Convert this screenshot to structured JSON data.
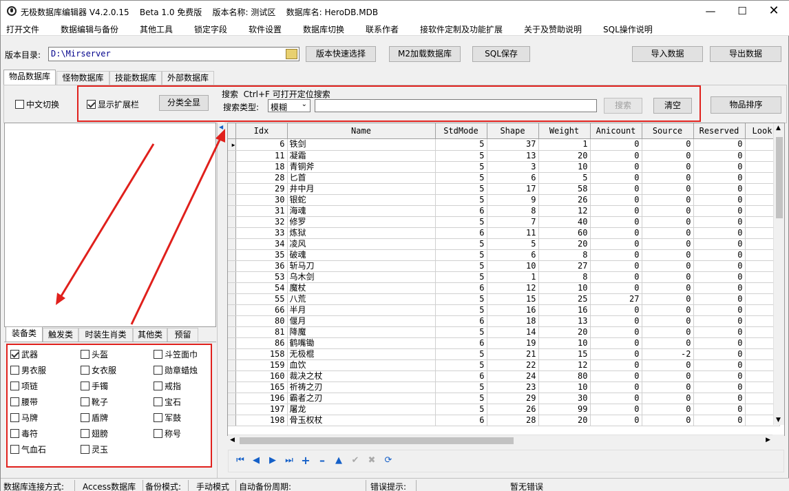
{
  "window": {
    "title": "无极数据库编辑器 V4.2.0.15    Beta 1.0 免费版    版本名称: 测试区    数据库名: HeroDB.MDB"
  },
  "menu": [
    "打开文件",
    "数据编辑与备份",
    "其他工具",
    "锁定字段",
    "软件设置",
    "数据库切换",
    "联系作者",
    "接软件定制及功能扩展",
    "关于及赞助说明",
    "SQL操作说明"
  ],
  "toolbar": {
    "dir_label": "版本目录:",
    "dir_value": "D:\\Mirserver",
    "quick_select": "版本快速选择",
    "m2_load": "M2加载数据库",
    "sql_save": "SQL保存",
    "import": "导入数据",
    "export": "导出数据"
  },
  "tabs": [
    "物品数据库",
    "怪物数据库",
    "技能数据库",
    "外部数据库"
  ],
  "options": {
    "cn_switch": "中文切换",
    "show_ext": "显示扩展栏",
    "show_all": "分类全显",
    "search_title": "搜索  Ctrl+F 可打开定位搜索",
    "search_type_label": "搜索类型:",
    "search_type_value": "模糊",
    "search_btn": "搜索",
    "clear_btn": "清空",
    "sort_btn": "物品排序"
  },
  "category_tabs": [
    "装备类",
    "触发类",
    "时装生肖类",
    "其他类",
    "预留"
  ],
  "categories": [
    {
      "label": "武器",
      "checked": true
    },
    {
      "label": "头盔",
      "checked": false
    },
    {
      "label": "斗笠面巾",
      "checked": false
    },
    {
      "label": "男衣服",
      "checked": false
    },
    {
      "label": "女衣服",
      "checked": false
    },
    {
      "label": "勋章蜡烛",
      "checked": false
    },
    {
      "label": "项链",
      "checked": false
    },
    {
      "label": "手镯",
      "checked": false
    },
    {
      "label": "戒指",
      "checked": false
    },
    {
      "label": "腰带",
      "checked": false
    },
    {
      "label": "靴子",
      "checked": false
    },
    {
      "label": "宝石",
      "checked": false
    },
    {
      "label": "马牌",
      "checked": false
    },
    {
      "label": "盾牌",
      "checked": false
    },
    {
      "label": "军鼓",
      "checked": false
    },
    {
      "label": "毒符",
      "checked": false
    },
    {
      "label": "翅膀",
      "checked": false
    },
    {
      "label": "称号",
      "checked": false
    },
    {
      "label": "气血石",
      "checked": false
    },
    {
      "label": "灵玉",
      "checked": false
    }
  ],
  "grid": {
    "columns": [
      "Idx",
      "Name",
      "StdMode",
      "Shape",
      "Weight",
      "Anicount",
      "Source",
      "Reserved",
      "Look"
    ],
    "rows": [
      [
        "6",
        "铁剑",
        "5",
        "37",
        "1",
        "0",
        "0",
        "0"
      ],
      [
        "11",
        "凝霜",
        "5",
        "13",
        "20",
        "0",
        "0",
        "0"
      ],
      [
        "18",
        "青铜斧",
        "5",
        "3",
        "10",
        "0",
        "0",
        "0"
      ],
      [
        "28",
        "匕首",
        "5",
        "6",
        "5",
        "0",
        "0",
        "0"
      ],
      [
        "29",
        "井中月",
        "5",
        "17",
        "58",
        "0",
        "0",
        "0"
      ],
      [
        "30",
        "银蛇",
        "5",
        "9",
        "26",
        "0",
        "0",
        "0"
      ],
      [
        "31",
        "海魂",
        "6",
        "8",
        "12",
        "0",
        "0",
        "0"
      ],
      [
        "32",
        "修罗",
        "5",
        "7",
        "40",
        "0",
        "0",
        "0"
      ],
      [
        "33",
        "炼狱",
        "6",
        "11",
        "60",
        "0",
        "0",
        "0"
      ],
      [
        "34",
        "凌风",
        "5",
        "5",
        "20",
        "0",
        "0",
        "0"
      ],
      [
        "35",
        "破魂",
        "5",
        "6",
        "8",
        "0",
        "0",
        "0"
      ],
      [
        "36",
        "斩马刀",
        "5",
        "10",
        "27",
        "0",
        "0",
        "0"
      ],
      [
        "53",
        "乌木剑",
        "5",
        "1",
        "8",
        "0",
        "0",
        "0"
      ],
      [
        "54",
        "魔杖",
        "6",
        "12",
        "10",
        "0",
        "0",
        "0"
      ],
      [
        "55",
        "八荒",
        "5",
        "15",
        "25",
        "27",
        "0",
        "0"
      ],
      [
        "66",
        "半月",
        "5",
        "16",
        "16",
        "0",
        "0",
        "0"
      ],
      [
        "80",
        "偃月",
        "6",
        "18",
        "13",
        "0",
        "0",
        "0"
      ],
      [
        "81",
        "降魔",
        "5",
        "14",
        "20",
        "0",
        "0",
        "0"
      ],
      [
        "86",
        "鹤嘴锄",
        "6",
        "19",
        "10",
        "0",
        "0",
        "0"
      ],
      [
        "158",
        "无极棍",
        "5",
        "21",
        "15",
        "0",
        "-2",
        "0"
      ],
      [
        "159",
        "血饮",
        "5",
        "22",
        "12",
        "0",
        "0",
        "0"
      ],
      [
        "160",
        "裁决之杖",
        "6",
        "24",
        "80",
        "0",
        "0",
        "0"
      ],
      [
        "165",
        "祈祷之刃",
        "5",
        "23",
        "10",
        "0",
        "0",
        "0"
      ],
      [
        "196",
        "霸者之刃",
        "5",
        "29",
        "30",
        "0",
        "0",
        "0"
      ],
      [
        "197",
        "屠龙",
        "5",
        "26",
        "99",
        "0",
        "0",
        "0"
      ],
      [
        "198",
        "骨玉权杖",
        "6",
        "28",
        "20",
        "0",
        "0",
        "0"
      ]
    ]
  },
  "status": {
    "conn_label": "数据库连接方式:",
    "conn_value": "Access数据库",
    "backup_label": "备份模式:",
    "backup_value": "手动模式",
    "auto_label": "自动备份周期:",
    "err_label": "错误提示:",
    "err_value": "暂无错误"
  },
  "colors": {
    "highlight": "#e0201c",
    "nav_blue": "#1560c8"
  }
}
